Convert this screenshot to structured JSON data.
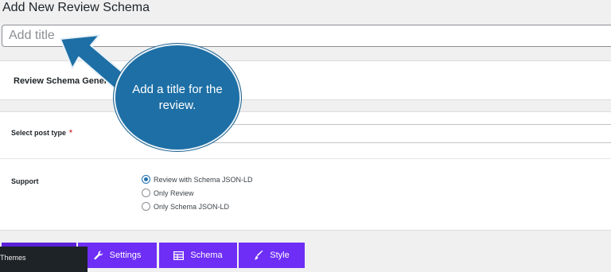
{
  "page_title": "Add New Review Schema",
  "title_input": {
    "placeholder": "Add title",
    "value": ""
  },
  "general_panel": {
    "title": "Review Schema General Settings"
  },
  "form": {
    "post_type": {
      "label": "Select post type",
      "required_mark": "*",
      "value": ""
    },
    "support": {
      "label": "Support",
      "options": [
        {
          "label": "Review with Schema JSON-LD",
          "checked": true
        },
        {
          "label": "Only Review",
          "checked": false
        },
        {
          "label": "Only Schema JSON-LD",
          "checked": false
        }
      ]
    }
  },
  "tabs": [
    {
      "label": "",
      "icon": "unknown"
    },
    {
      "label": "Settings",
      "icon": "wrench-icon"
    },
    {
      "label": "Schema",
      "icon": "table-icon"
    },
    {
      "label": "Style",
      "icon": "brush-icon"
    }
  ],
  "admin_menu": {
    "item": "Themes"
  },
  "callout": {
    "text": "Add a title for the review."
  },
  "colors": {
    "tab_purple": "#6e2ef5",
    "callout_blue": "#1d6fa5",
    "radio_blue": "#2271b1",
    "required_red": "#d63638"
  }
}
